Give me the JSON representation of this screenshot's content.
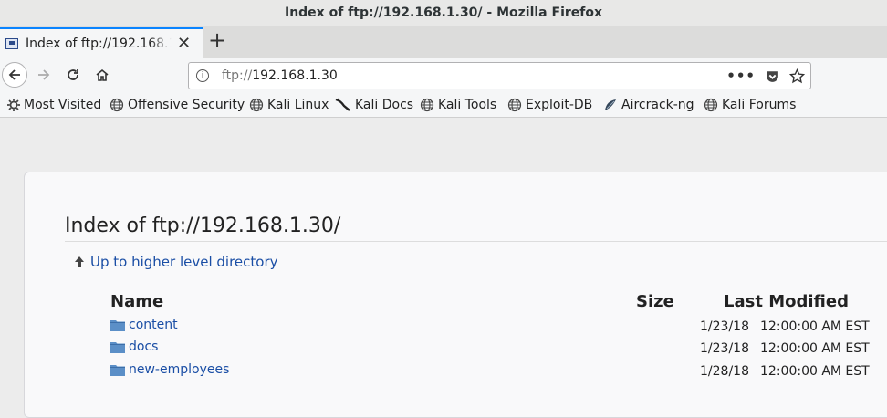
{
  "window": {
    "title": "Index of ftp://192.168.1.30/ - Mozilla Firefox"
  },
  "tab": {
    "label": "Index of ftp://192.168.1.30/"
  },
  "urlbar": {
    "scheme": "ftp://",
    "host": "192.168.1.30"
  },
  "bookmarks": [
    {
      "label": "Most Visited",
      "icon": "gear-icon"
    },
    {
      "label": "Offensive Security",
      "icon": "globe-icon"
    },
    {
      "label": "Kali Linux",
      "icon": "globe-icon"
    },
    {
      "label": "Kali Docs",
      "icon": "kali-dragon-icon"
    },
    {
      "label": "Kali Tools",
      "icon": "globe-icon"
    },
    {
      "label": "Exploit-DB",
      "icon": "globe-icon"
    },
    {
      "label": "Aircrack-ng",
      "icon": "aircrack-icon"
    },
    {
      "label": "Kali Forums",
      "icon": "globe-icon"
    }
  ],
  "page": {
    "title": "Index of ftp://192.168.1.30/",
    "up_link": "Up to higher level directory",
    "columns": {
      "name": "Name",
      "size": "Size",
      "modified": "Last Modified"
    },
    "rows": [
      {
        "name": "content",
        "date": "1/23/18",
        "time": "12:00:00 AM EST"
      },
      {
        "name": "docs",
        "date": "1/23/18",
        "time": "12:00:00 AM EST"
      },
      {
        "name": "new-employees",
        "date": "1/28/18",
        "time": "12:00:00 AM EST"
      }
    ]
  },
  "colors": {
    "link": "#1a4ea5",
    "tab_accent": "#0a84ff",
    "folder": "#5b8fc7"
  }
}
